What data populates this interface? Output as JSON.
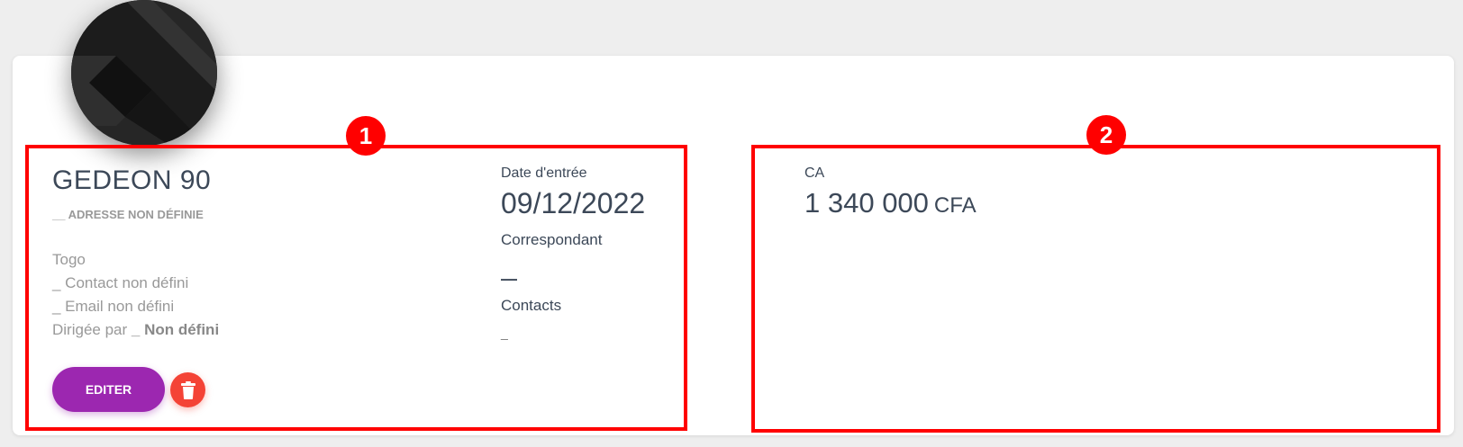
{
  "company": {
    "name": "GEDEON 90",
    "address": "__ ADRESSE NON DÉFINIE",
    "country": "Togo",
    "contact": "_ Contact non défini",
    "email": "_ Email non défini",
    "directed_by_label": "Dirigée par",
    "directed_by_value": "_ Non défini"
  },
  "actions": {
    "edit_label": "EDITER"
  },
  "details": {
    "entry_date_label": "Date d'entrée",
    "entry_date": "09/12/2022",
    "correspondent_label": "Correspondant",
    "correspondent_value": "—",
    "contacts_label": "Contacts",
    "contacts_value": "_"
  },
  "revenue": {
    "label": "CA",
    "value": "1 340 000",
    "unit": "CFA"
  },
  "annotations": [
    {
      "label": "1"
    },
    {
      "label": "2"
    }
  ],
  "colors": {
    "accent": "#9c27b0",
    "danger": "#f44336",
    "annotation": "#ff0000"
  }
}
